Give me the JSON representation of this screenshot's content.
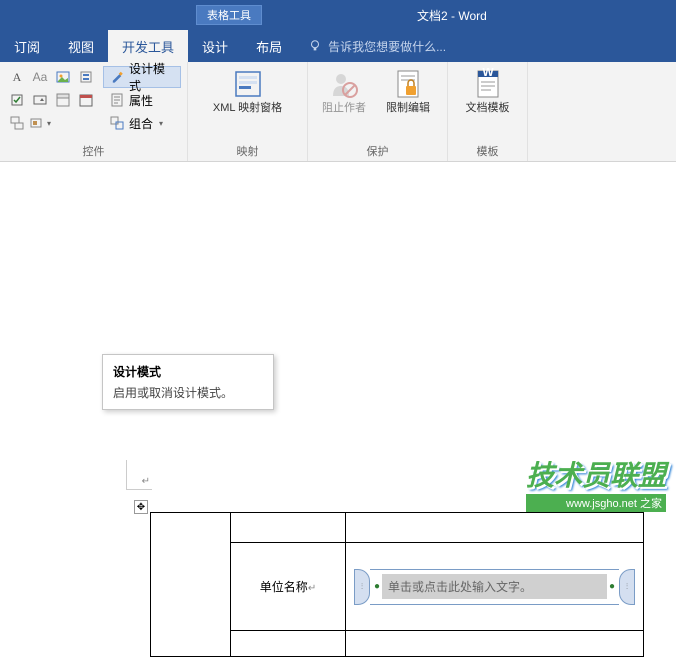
{
  "title": {
    "context_label": "表格工具",
    "doc_name": "文档2 - Word"
  },
  "tabs": {
    "review_frag": "订阅",
    "view": "视图",
    "developer": "开发工具",
    "design": "设计",
    "layout": "布局",
    "tell_me_placeholder": "告诉我您想要做什么..."
  },
  "ribbon": {
    "controls": {
      "design_mode": "设计模式",
      "properties": "属性",
      "group": "组合",
      "group_label": "控件"
    },
    "mapping": {
      "xml": "XML 映射窗格",
      "group_label": "映射"
    },
    "protect": {
      "block_authors": "阻止作者",
      "restrict_editing": "限制编辑",
      "group_label": "保护"
    },
    "templates": {
      "doc_template": "文档模板",
      "group_label": "模板"
    }
  },
  "tooltip": {
    "title": "设计模式",
    "desc": "启用或取消设计模式。"
  },
  "table": {
    "cell_label": "单位名称",
    "content_control_placeholder": "单击或点击此处输入文字。"
  },
  "watermark": {
    "main": "技术员联盟",
    "sub": "www.jsgho.net 之家"
  }
}
